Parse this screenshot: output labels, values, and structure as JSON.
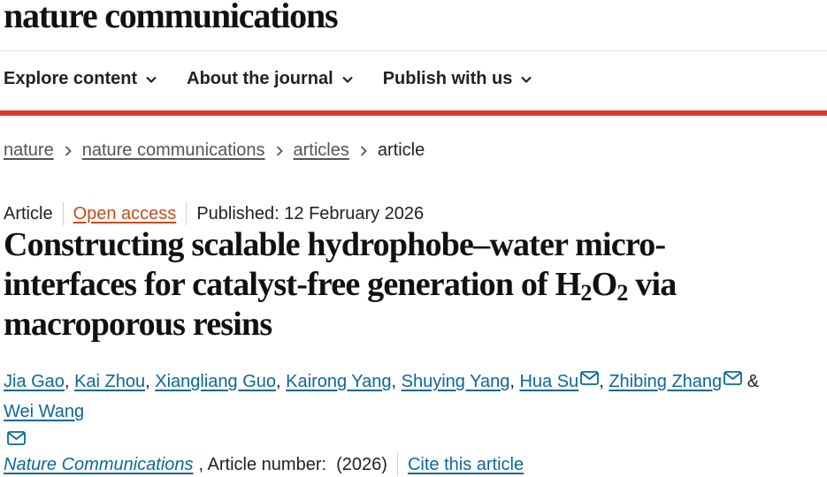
{
  "site": {
    "title": "nature communications"
  },
  "nav": [
    {
      "label": "Explore content"
    },
    {
      "label": "About the journal"
    },
    {
      "label": "Publish with us"
    }
  ],
  "breadcrumb": {
    "items": [
      "nature",
      "nature communications",
      "articles"
    ],
    "current": "article"
  },
  "meta": {
    "type": "Article",
    "access": "Open access",
    "published": "Published: 12 February 2026"
  },
  "title": {
    "line1": "Constructing scalable hydrophobe–water micro-",
    "line2_a": "interfaces for catalyst-free generation of H",
    "sub1": "2",
    "mid": "O",
    "sub2": "2",
    "line2_b": " via",
    "line3": "macroporous resins"
  },
  "authors": [
    {
      "name": "Jia Gao",
      "sep": ", "
    },
    {
      "name": "Kai Zhou",
      "sep": ", "
    },
    {
      "name": "Xiangliang Guo",
      "sep": ", "
    },
    {
      "name": "Kairong Yang",
      "sep": ", "
    },
    {
      "name": "Shuying Yang",
      "sep": ", "
    },
    {
      "name": "Hua Su",
      "sep": ", "
    },
    {
      "name": "Zhibing Zhang",
      "sep": " & "
    },
    {
      "name": "Wei Wang",
      "sep": ""
    }
  ],
  "citation": {
    "journal": "Nature Communications",
    "article_number": ", Article number:  (2026)",
    "cite_link": "Cite this article"
  },
  "colors": {
    "accent_red": "#e0362c",
    "link_blue": "#0d6799",
    "open_access": "#c44d1e"
  },
  "icons": {
    "nav_dropdown": "chevron-down-icon",
    "breadcrumb_separator": "chevron-right-icon",
    "corresponding_author": "mail-icon"
  }
}
